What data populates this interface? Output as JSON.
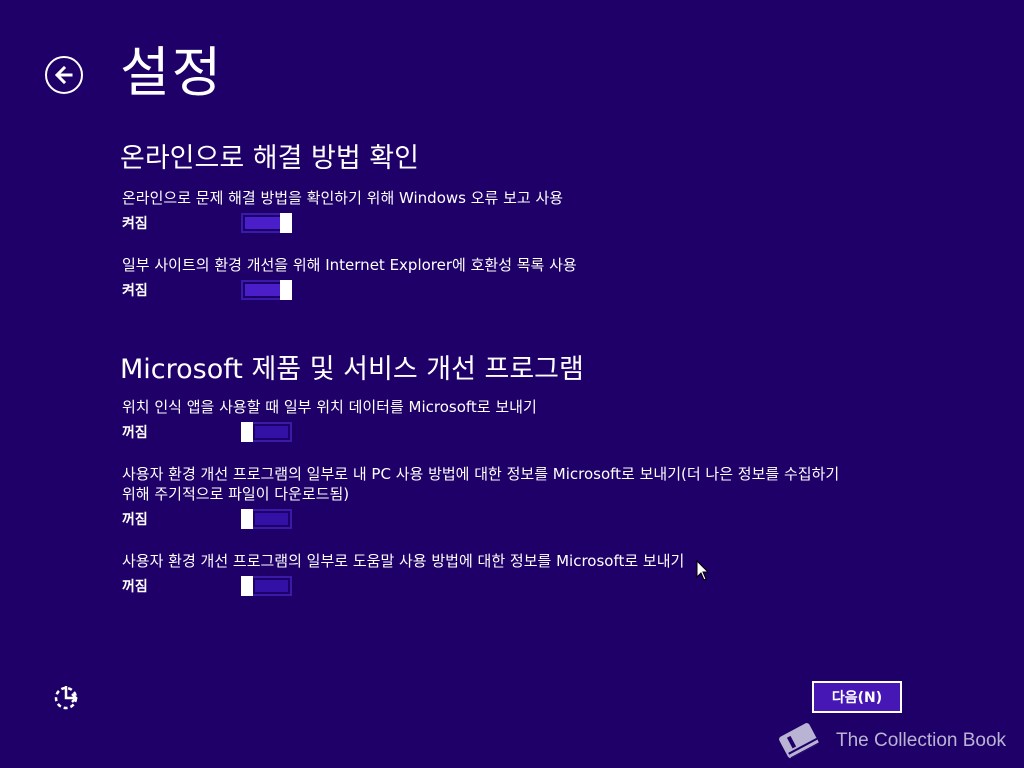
{
  "page": {
    "title": "설정"
  },
  "sections": [
    {
      "heading": "온라인으로 해결 방법 확인",
      "settings": [
        {
          "description": "온라인으로 문제 해결 방법을 확인하기 위해 Windows 오류 보고 사용",
          "state": "켜짐",
          "on": true
        },
        {
          "description": "일부 사이트의 환경 개선을 위해 Internet Explorer에 호환성 목록 사용",
          "state": "켜짐",
          "on": true
        }
      ]
    },
    {
      "heading": "Microsoft 제품 및 서비스 개선 프로그램",
      "settings": [
        {
          "description": "위치 인식 앱을 사용할 때 일부 위치 데이터를 Microsoft로 보내기",
          "state": "꺼짐",
          "on": false
        },
        {
          "description": "사용자 환경 개선 프로그램의 일부로 내 PC 사용 방법에 대한 정보를 Microsoft로 보내기(더 나은 정보를 수집하기",
          "description_line2": "위해 주기적으로 파일이 다운로드됨)",
          "state": "꺼짐",
          "on": false
        },
        {
          "description": "사용자 환경 개선 프로그램의 일부로 도움말 사용 방법에 대한 정보를 Microsoft로 보내기",
          "state": "꺼짐",
          "on": false
        }
      ]
    }
  ],
  "footer": {
    "next_label": "다음(N)",
    "watermark": "The Collection Book"
  },
  "icons": {
    "back": "back-arrow-icon",
    "ease_of_access": "ease-of-access-icon",
    "watermark": "book-icon"
  },
  "colors": {
    "background": "#1f0068",
    "accent": "#4a1fc9",
    "text": "#ffffff"
  }
}
